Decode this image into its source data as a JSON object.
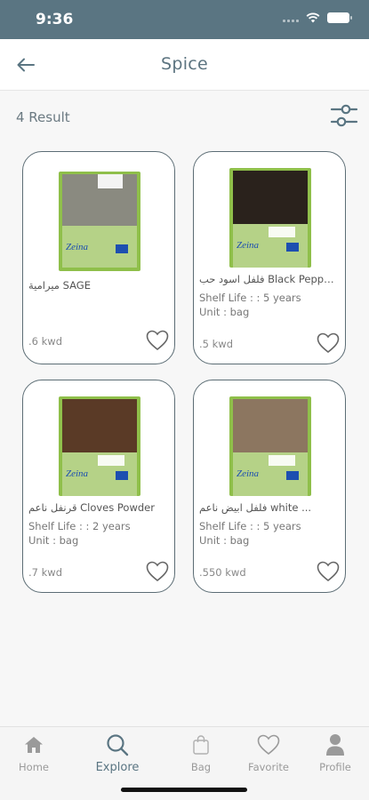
{
  "status_bar": {
    "time": "9:36"
  },
  "header": {
    "title": "Spice"
  },
  "results": {
    "count_text": "4 Result"
  },
  "products": [
    {
      "name": "ميرامية SAGE",
      "shelf_life": "",
      "unit": "",
      "price": ".6 kwd",
      "contents_color": "#8a8a80"
    },
    {
      "name": "فلفل اسود حب Black Pepper...",
      "shelf_life": "Shelf Life : : 5 years",
      "unit": "Unit : bag",
      "price": ".5 kwd",
      "contents_color": "#2a221c"
    },
    {
      "name": "قرنفل ناعم Cloves Powder",
      "shelf_life": "Shelf Life : : 2 years",
      "unit": "Unit : bag",
      "price": ".7 kwd",
      "contents_color": "#5a3a26"
    },
    {
      "name": "فلفل ابيض ناعم white ...",
      "shelf_life": "Shelf Life : : 5 years",
      "unit": "Unit : bag",
      "price": ".550 kwd",
      "contents_color": "#8c7660"
    }
  ],
  "packaging": {
    "brand_text": "Zeina"
  },
  "bottom_nav": [
    {
      "label": "Home",
      "icon": "home-icon",
      "active": false
    },
    {
      "label": "Explore",
      "icon": "search-icon",
      "active": true
    },
    {
      "label": "Bag",
      "icon": "bag-icon",
      "active": false
    },
    {
      "label": "Favorite",
      "icon": "heart-icon",
      "active": false
    },
    {
      "label": "Profile",
      "icon": "profile-icon",
      "active": false
    }
  ],
  "colors": {
    "primary": "#5a7582",
    "card_border": "#5c6d75",
    "package_green": "#8fbf4a"
  }
}
